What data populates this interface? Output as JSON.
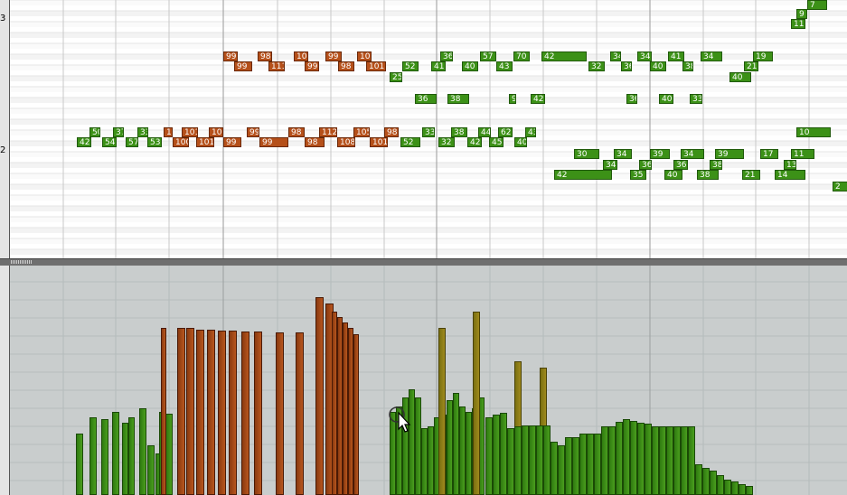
{
  "ruler": {
    "octave_labels": [
      "3",
      "2"
    ]
  },
  "notes": [
    {
      "t": "99",
      "c": "o"
    },
    {
      "t": "99",
      "c": "o"
    },
    {
      "t": "98",
      "c": "o"
    },
    {
      "t": "111",
      "c": "o"
    },
    {
      "t": "104",
      "c": "o"
    },
    {
      "t": "99",
      "c": "o"
    },
    {
      "t": "99",
      "c": "o"
    },
    {
      "t": "98",
      "c": "o"
    },
    {
      "t": "108",
      "c": "o"
    },
    {
      "t": "101",
      "c": "o"
    },
    {
      "t": "52",
      "c": "g"
    },
    {
      "t": "25",
      "c": "g"
    },
    {
      "t": "36",
      "c": "g"
    },
    {
      "t": "41",
      "c": "g"
    },
    {
      "t": "57",
      "c": "g"
    },
    {
      "t": "40",
      "c": "g"
    },
    {
      "t": "70",
      "c": "g"
    },
    {
      "t": "43",
      "c": "g"
    },
    {
      "t": "42",
      "c": "g"
    },
    {
      "t": "32",
      "c": "g"
    },
    {
      "t": "34",
      "c": "g"
    },
    {
      "t": "36",
      "c": "g"
    },
    {
      "t": "34",
      "c": "g"
    },
    {
      "t": "40",
      "c": "g"
    },
    {
      "t": "41",
      "c": "g"
    },
    {
      "t": "38",
      "c": "g"
    },
    {
      "t": "34",
      "c": "g"
    },
    {
      "t": "19",
      "c": "g"
    },
    {
      "t": "21",
      "c": "g"
    },
    {
      "t": "40",
      "c": "g"
    },
    {
      "t": "36",
      "c": "g"
    },
    {
      "t": "38",
      "c": "g"
    },
    {
      "t": "9",
      "c": "g"
    },
    {
      "t": "42",
      "c": "g"
    },
    {
      "t": "36",
      "c": "g"
    },
    {
      "t": "40",
      "c": "g"
    },
    {
      "t": "33",
      "c": "g"
    },
    {
      "t": "50",
      "c": "g"
    },
    {
      "t": "37",
      "c": "g"
    },
    {
      "t": "33",
      "c": "g"
    },
    {
      "t": "100",
      "c": "o"
    },
    {
      "t": "101",
      "c": "o"
    },
    {
      "t": "100",
      "c": "o"
    },
    {
      "t": "99",
      "c": "o"
    },
    {
      "t": "98",
      "c": "o"
    },
    {
      "t": "112",
      "c": "o"
    },
    {
      "t": "105",
      "c": "o"
    },
    {
      "t": "98",
      "c": "o"
    },
    {
      "t": "33",
      "c": "g"
    },
    {
      "t": "38",
      "c": "g"
    },
    {
      "t": "44",
      "c": "g"
    },
    {
      "t": "62",
      "c": "g"
    },
    {
      "t": "43",
      "c": "g"
    },
    {
      "t": "42",
      "c": "g"
    },
    {
      "t": "54",
      "c": "g"
    },
    {
      "t": "57",
      "c": "g"
    },
    {
      "t": "53",
      "c": "g"
    },
    {
      "t": "100",
      "c": "o"
    },
    {
      "t": "101",
      "c": "o"
    },
    {
      "t": "99",
      "c": "o"
    },
    {
      "t": "99",
      "c": "o"
    },
    {
      "t": "98",
      "c": "o"
    },
    {
      "t": "108",
      "c": "o"
    },
    {
      "t": "101",
      "c": "o"
    },
    {
      "t": "52",
      "c": "g"
    },
    {
      "t": "32",
      "c": "g"
    },
    {
      "t": "42",
      "c": "g"
    },
    {
      "t": "45",
      "c": "g"
    },
    {
      "t": "40",
      "c": "g"
    },
    {
      "t": "30",
      "c": "g"
    },
    {
      "t": "34",
      "c": "g"
    },
    {
      "t": "39",
      "c": "g"
    },
    {
      "t": "34",
      "c": "g"
    },
    {
      "t": "39",
      "c": "g"
    },
    {
      "t": "17",
      "c": "g"
    },
    {
      "t": "11",
      "c": "g"
    },
    {
      "t": "34",
      "c": "g"
    },
    {
      "t": "36",
      "c": "g"
    },
    {
      "t": "36",
      "c": "g"
    },
    {
      "t": "38",
      "c": "g"
    },
    {
      "t": "13",
      "c": "g"
    },
    {
      "t": "42",
      "c": "g"
    },
    {
      "t": "35",
      "c": "g"
    },
    {
      "t": "40",
      "c": "g"
    },
    {
      "t": "38",
      "c": "g"
    },
    {
      "t": "21",
      "c": "g"
    },
    {
      "t": "14",
      "c": "g"
    },
    {
      "t": "10",
      "c": "g"
    },
    {
      "t": "2",
      "c": "g"
    },
    {
      "t": "7",
      "c": "g"
    },
    {
      "t": "9",
      "c": "g"
    },
    {
      "t": "11",
      "c": "g"
    }
  ],
  "velocity": {
    "max": 127,
    "bars": [
      {
        "v": 55,
        "c": "g"
      },
      {
        "v": 70,
        "c": "g"
      },
      {
        "v": 68,
        "c": "g"
      },
      {
        "v": 75,
        "c": "g"
      },
      {
        "v": 65,
        "c": "g"
      },
      {
        "v": 70,
        "c": "g"
      },
      {
        "v": 78,
        "c": "g"
      },
      {
        "v": 45,
        "c": "g"
      },
      {
        "v": 37,
        "c": "g"
      },
      {
        "v": 75,
        "c": "g"
      },
      {
        "v": 73,
        "c": "g"
      },
      {
        "v": 150,
        "c": "o"
      },
      {
        "v": 150,
        "c": "o"
      },
      {
        "v": 150,
        "c": "o"
      },
      {
        "v": 149,
        "c": "o"
      },
      {
        "v": 149,
        "c": "o"
      },
      {
        "v": 148,
        "c": "o"
      },
      {
        "v": 148,
        "c": "o"
      },
      {
        "v": 147,
        "c": "o"
      },
      {
        "v": 147,
        "c": "o"
      },
      {
        "v": 146,
        "c": "o"
      },
      {
        "v": 146,
        "c": "o"
      },
      {
        "v": 178,
        "c": "o"
      },
      {
        "v": 172,
        "c": "o"
      },
      {
        "v": 165,
        "c": "o"
      },
      {
        "v": 160,
        "c": "o"
      },
      {
        "v": 155,
        "c": "o"
      },
      {
        "v": 150,
        "c": "o"
      },
      {
        "v": 145,
        "c": "o"
      },
      {
        "v": 75,
        "c": "g"
      },
      {
        "v": 80,
        "c": "g"
      },
      {
        "v": 88,
        "c": "g"
      },
      {
        "v": 95,
        "c": "g"
      },
      {
        "v": 88,
        "c": "g"
      },
      {
        "v": 60,
        "c": "g"
      },
      {
        "v": 62,
        "c": "g"
      },
      {
        "v": 70,
        "c": "g"
      },
      {
        "v": 72,
        "c": "g"
      },
      {
        "v": 85,
        "c": "g"
      },
      {
        "v": 92,
        "c": "g"
      },
      {
        "v": 80,
        "c": "g"
      },
      {
        "v": 75,
        "c": "g"
      },
      {
        "v": 78,
        "c": "g"
      },
      {
        "v": 88,
        "c": "g"
      },
      {
        "v": 150,
        "c": "y"
      },
      {
        "v": 165,
        "c": "y"
      },
      {
        "v": 120,
        "c": "y"
      },
      {
        "v": 115,
        "c": "y"
      },
      {
        "v": 70,
        "c": "g"
      },
      {
        "v": 72,
        "c": "g"
      },
      {
        "v": 74,
        "c": "g"
      },
      {
        "v": 60,
        "c": "g"
      },
      {
        "v": 62,
        "c": "g"
      },
      {
        "v": 63,
        "c": "g"
      },
      {
        "v": 63,
        "c": "g"
      },
      {
        "v": 63,
        "c": "g"
      },
      {
        "v": 63,
        "c": "g"
      },
      {
        "v": 48,
        "c": "g"
      },
      {
        "v": 45,
        "c": "g"
      },
      {
        "v": 52,
        "c": "g"
      },
      {
        "v": 52,
        "c": "g"
      },
      {
        "v": 55,
        "c": "g"
      },
      {
        "v": 55,
        "c": "g"
      },
      {
        "v": 55,
        "c": "g"
      },
      {
        "v": 62,
        "c": "g"
      },
      {
        "v": 62,
        "c": "g"
      },
      {
        "v": 66,
        "c": "g"
      },
      {
        "v": 68,
        "c": "g"
      },
      {
        "v": 67,
        "c": "g"
      },
      {
        "v": 65,
        "c": "g"
      },
      {
        "v": 64,
        "c": "g"
      },
      {
        "v": 62,
        "c": "g"
      },
      {
        "v": 62,
        "c": "g"
      },
      {
        "v": 62,
        "c": "g"
      },
      {
        "v": 62,
        "c": "g"
      },
      {
        "v": 62,
        "c": "g"
      },
      {
        "v": 62,
        "c": "g"
      },
      {
        "v": 28,
        "c": "g"
      },
      {
        "v": 24,
        "c": "g"
      },
      {
        "v": 22,
        "c": "g"
      },
      {
        "v": 18,
        "c": "g"
      },
      {
        "v": 14,
        "c": "g"
      },
      {
        "v": 12,
        "c": "g"
      },
      {
        "v": 10,
        "c": "g"
      },
      {
        "v": 8,
        "c": "g"
      },
      {
        "v": 5,
        "c": "g"
      }
    ]
  }
}
